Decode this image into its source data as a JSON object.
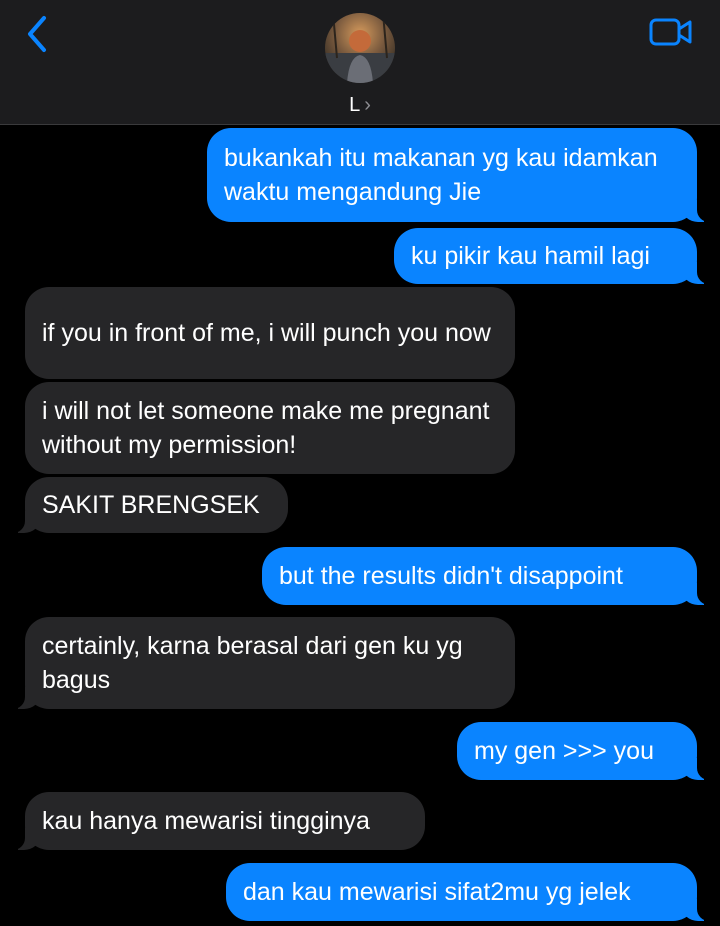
{
  "header": {
    "contact_name": "L",
    "chevron": "›",
    "back_icon": "chevron-left-icon",
    "video_icon": "video-camera-icon",
    "accent_color": "#0a84ff"
  },
  "messages": [
    {
      "from": "me",
      "text": "bukankah itu makanan yg kau idamkan waktu mengandung Jie"
    },
    {
      "from": "me",
      "text": "ku pikir kau hamil lagi"
    },
    {
      "from": "them",
      "text": "if you in front of me, i will punch you now"
    },
    {
      "from": "them",
      "text": "i will not let someone make me pregnant without my permission!"
    },
    {
      "from": "them",
      "text": "SAKIT BRENGSEK"
    },
    {
      "from": "me",
      "text": "but the results didn't disappoint"
    },
    {
      "from": "them",
      "text": "certainly, karna berasal dari gen ku yg bagus"
    },
    {
      "from": "me",
      "text": "my gen >>> you"
    },
    {
      "from": "them",
      "text": "kau hanya mewarisi tingginya"
    },
    {
      "from": "me",
      "text": "dan kau mewarisi sifat2mu yg jelek"
    }
  ]
}
